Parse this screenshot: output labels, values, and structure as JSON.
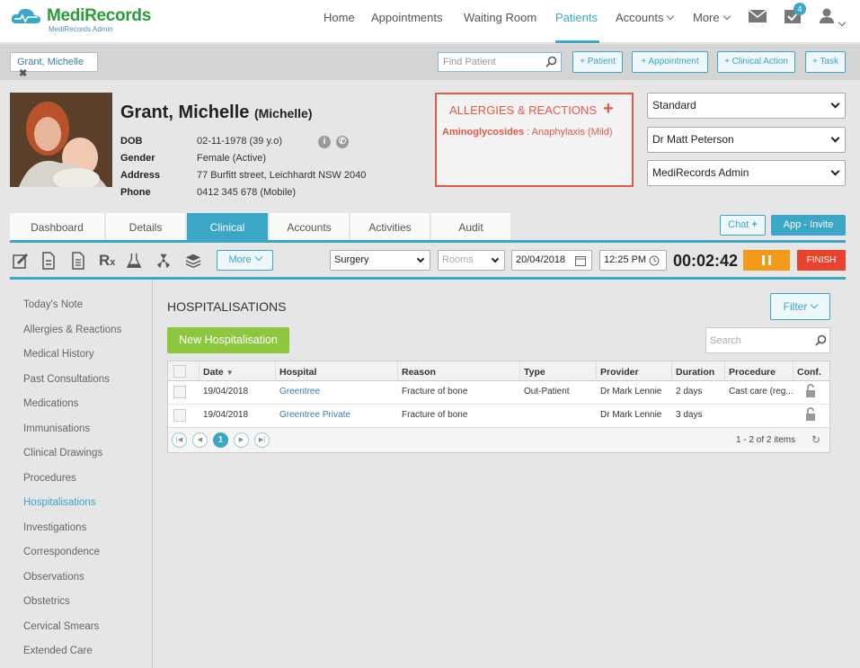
{
  "brand": {
    "name": "MediRecords",
    "sub": "MediRecords Admin"
  },
  "nav": {
    "home": "Home",
    "appointments": "Appointments",
    "waiting_room": "Waiting Room",
    "patients": "Patients",
    "accounts": "Accounts",
    "more": "More",
    "task_badge": "4"
  },
  "patient_bar": {
    "chip": "Grant, Michelle",
    "find_placeholder": "Find Patient",
    "btn_patient": "+ Patient",
    "btn_appointment": "+ Appointment",
    "btn_clinical_action": "+ Clinical Action",
    "btn_task": "+ Task"
  },
  "patient": {
    "name": "Grant, Michelle",
    "preferred": "(Michelle)",
    "dob_label": "DOB",
    "dob": "02-11-1978 (39 y.o)",
    "gender_label": "Gender",
    "gender": "Female (Active)",
    "address_label": "Address",
    "address": "77 Burfitt street, Leichhardt NSW 2040",
    "phone_label": "Phone",
    "phone": "0412 345 678 (Mobile)"
  },
  "allergies": {
    "title": "ALLERGIES & REACTIONS",
    "item_name": "Aminoglycosides",
    "item_reaction": " : Anaphylaxis (Mild)"
  },
  "selects": {
    "billing": "Standard",
    "doctor": "Dr Matt Peterson",
    "location": "MediRecords Admin"
  },
  "tabs": [
    "Dashboard",
    "Details",
    "Clinical",
    "Accounts",
    "Activities",
    "Audit"
  ],
  "tab_actions": {
    "chat": "Chat",
    "invite": "App - Invite"
  },
  "toolbar": {
    "more": "More",
    "visit_type": "Surgery",
    "rooms_placeholder": "Rooms",
    "date": "20/04/2018",
    "time": "12:25 PM",
    "timer": "00:02:42",
    "finish": "FINISH"
  },
  "sidebar": [
    "Today's Note",
    "Allergies & Reactions",
    "Medical History",
    "Past Consultations",
    "Medications",
    "Immunisations",
    "Clinical Drawings",
    "Procedures",
    "Hospitalisations",
    "Investigations",
    "Correspondence",
    "Observations",
    "Obstetrics",
    "Cervical Smears",
    "Extended Care"
  ],
  "main": {
    "title": "HOSPITALISATIONS",
    "filter": "Filter",
    "new_button": "New Hospitalisation",
    "search_placeholder": "Search"
  },
  "table": {
    "columns": [
      "Date",
      "Hospital",
      "Reason",
      "Type",
      "Provider",
      "Duration",
      "Procedure",
      "Conf."
    ],
    "rows": [
      {
        "date": "19/04/2018",
        "hospital": "Greentree",
        "reason": "Fracture of bone",
        "type": "Out-Patient",
        "provider": "Dr Mark Lennie",
        "duration": "2 days",
        "procedure": "Cast care (reg..."
      },
      {
        "date": "19/04/2018",
        "hospital": "Greentree Private",
        "reason": "Fracture of bone",
        "type": "",
        "provider": "Dr Mark Lennie",
        "duration": "3 days",
        "procedure": ""
      }
    ],
    "page": "1",
    "summary": "1 - 2 of 2 items"
  },
  "colors": {
    "accent": "#3ba6c6",
    "danger": "#e05a4a",
    "green": "#8dc63f",
    "orange": "#f49a1a"
  }
}
